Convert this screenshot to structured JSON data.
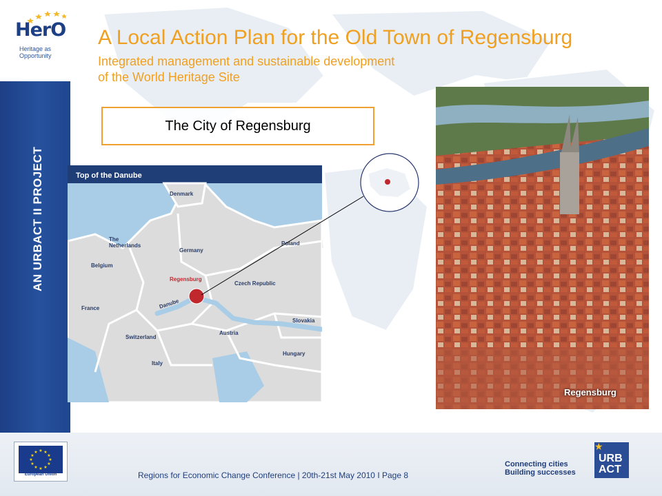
{
  "logo": {
    "mark": "HerO",
    "subtitle": "Heritage as Opportunity"
  },
  "sidebar": {
    "project_label": "AN URBACT II PROJECT"
  },
  "slide": {
    "title": "A Local Action Plan for the Old Town of Regensburg",
    "subtitle_line1": "Integrated management and sustainable development",
    "subtitle_line2": "of the World Heritage Site",
    "city_box": "The City of Regensburg"
  },
  "map": {
    "header": "Top of the Danube",
    "labels": {
      "denmark": "Denmark",
      "netherlands_1": "The",
      "netherlands_2": "Netherlands",
      "germany": "Germany",
      "poland": "Poland",
      "belgium": "Belgium",
      "regensburg": "Regensburg",
      "czech": "Czech Republic",
      "france": "France",
      "danube": "Danube",
      "slovakia": "Slovakia",
      "switzerland": "Switzerland",
      "austria": "Austria",
      "hungary": "Hungary",
      "italy": "Italy"
    }
  },
  "photo": {
    "caption": "Regensburg"
  },
  "footer": {
    "text": "Regions for Economic Change Conference | 20th-21st May 2010 I Page 8",
    "eu_label": "European Union",
    "tagline_1": "Connecting cities",
    "tagline_2": "Building successes",
    "urbact_1": "URB",
    "urbact_2": "ACT"
  },
  "colors": {
    "accent": "#f0a020",
    "brand_blue": "#1d3f86",
    "marker": "#c0282e"
  }
}
